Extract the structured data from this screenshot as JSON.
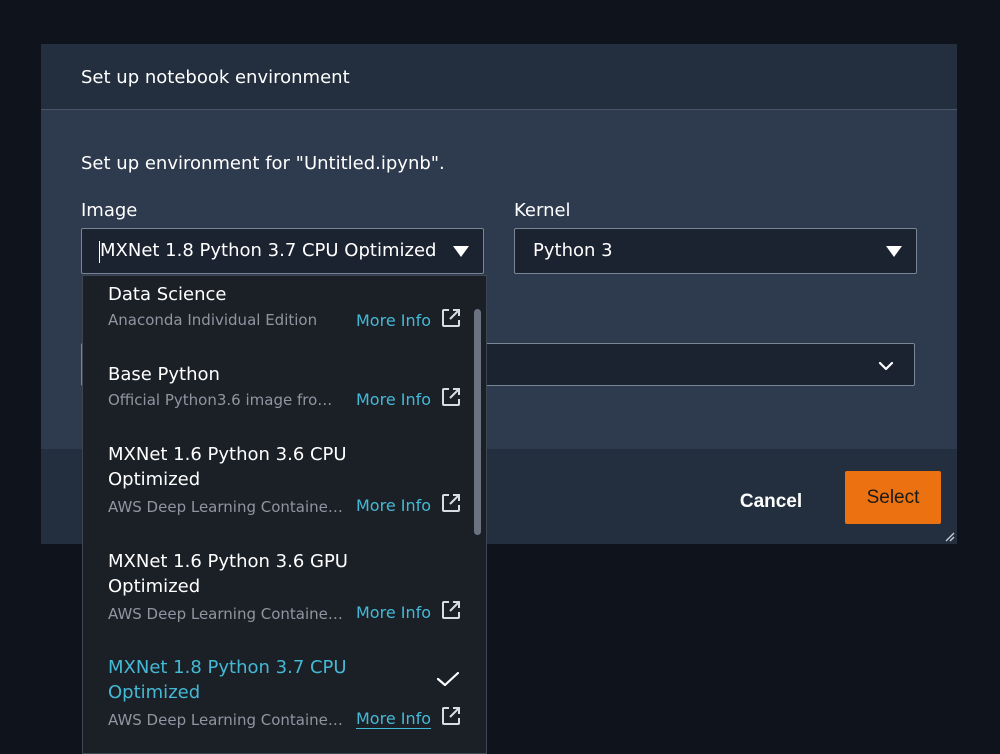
{
  "dialog": {
    "title": "Set up notebook environment",
    "description": "Set up environment for \"Untitled.ipynb\".",
    "image_label": "Image",
    "image_value": "MXNet 1.8 Python 3.7 CPU Optimized",
    "kernel_label": "Kernel",
    "kernel_value": "Python 3",
    "cancel_label": "Cancel",
    "select_label": "Select"
  },
  "dropdown": {
    "options": [
      {
        "title": "Data Science",
        "desc": "Anaconda Individual Edition",
        "more": "More Info"
      },
      {
        "title": "Base Python",
        "desc": "Official Python3.6 image fro…",
        "more": "More Info"
      },
      {
        "title": "MXNet 1.6 Python 3.6 CPU Optimized",
        "desc": "AWS Deep Learning Containe…",
        "more": "More Info"
      },
      {
        "title": "MXNet 1.6 Python 3.6 GPU Optimized",
        "desc": "AWS Deep Learning Containe…",
        "more": "More Info"
      },
      {
        "title": "MXNet 1.8 Python 3.7 CPU Optimized",
        "desc": "AWS Deep Learning Containe…",
        "more": "More Info",
        "selected": true
      }
    ]
  },
  "colors": {
    "accent": "#44b9d6",
    "primary_button": "#ec7211",
    "dialog_bg": "#2e3a4d",
    "dropdown_bg": "#1b1f26"
  }
}
